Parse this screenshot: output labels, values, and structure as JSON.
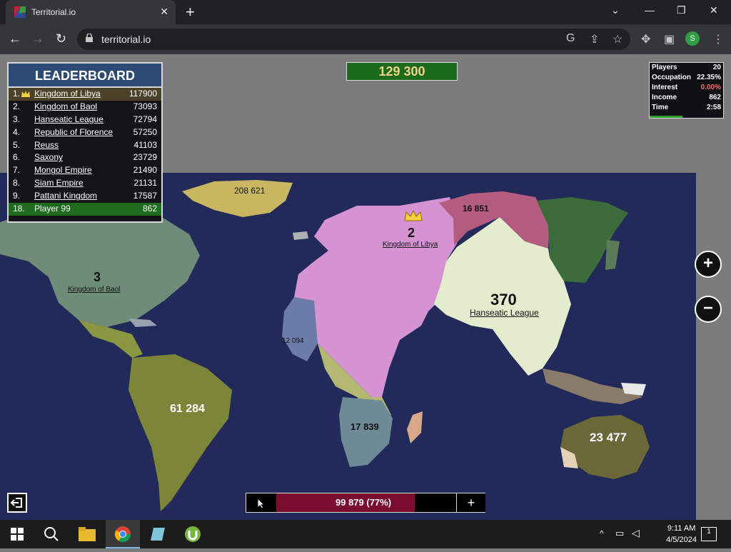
{
  "browser": {
    "tab_title": "Territorial.io",
    "url": "territorial.io",
    "profile_initial": "S"
  },
  "game": {
    "gold": "129 300",
    "leaderboard": {
      "title": "LEADERBOARD",
      "rows": [
        {
          "rank": "1.",
          "name": "Kingdom of Libya",
          "score": "117900"
        },
        {
          "rank": "2.",
          "name": "Kingdom of Baol",
          "score": "73093"
        },
        {
          "rank": "3.",
          "name": "Hanseatic League",
          "score": "72794"
        },
        {
          "rank": "4.",
          "name": "Republic of Florence",
          "score": "57250"
        },
        {
          "rank": "5.",
          "name": "Reuss",
          "score": "41103"
        },
        {
          "rank": "6.",
          "name": "Saxony",
          "score": "23729"
        },
        {
          "rank": "7.",
          "name": "Mongol Empire",
          "score": "21490"
        },
        {
          "rank": "8.",
          "name": "Siam Empire",
          "score": "21131"
        },
        {
          "rank": "9.",
          "name": "Pattani Kingdom",
          "score": "17587"
        }
      ],
      "self": {
        "rank": "18.",
        "name": "Player 99",
        "score": "862"
      }
    },
    "stats": {
      "players_label": "Players",
      "players": "20",
      "occupation_label": "Occupation",
      "occupation": "22.35%",
      "interest_label": "Interest",
      "interest": "0.00%",
      "income_label": "Income",
      "income": "862",
      "time_label": "Time",
      "time": "2:58",
      "time_progress": 0.45
    },
    "map_labels": {
      "greenland": "208 621",
      "russia_east": "16 851",
      "libya_count": "2",
      "libya_name": "Kingdom of Libya",
      "baol_count": "3",
      "baol_name": "Kingdom of Baol",
      "hanseatic_count": "370",
      "hanseatic_name": "Hanseatic League",
      "west_africa": "12 094",
      "south_america": "61 284",
      "southern_africa": "17 839",
      "australia": "23 477"
    },
    "zoom_in": "+",
    "zoom_out": "−",
    "troops": {
      "label": "99 879 (77%)",
      "fraction": 0.77,
      "plus": "+"
    }
  },
  "taskbar": {
    "time": "9:11 AM",
    "date": "4/5/2024",
    "notifications": "1"
  },
  "colors": {
    "ocean": "#222a5a",
    "libya": "#d693d4",
    "hanseatic": "#e4ecce",
    "baol": "#6f8c78",
    "mongol": "#3b6b3b",
    "russia_east": "#b45c80"
  }
}
